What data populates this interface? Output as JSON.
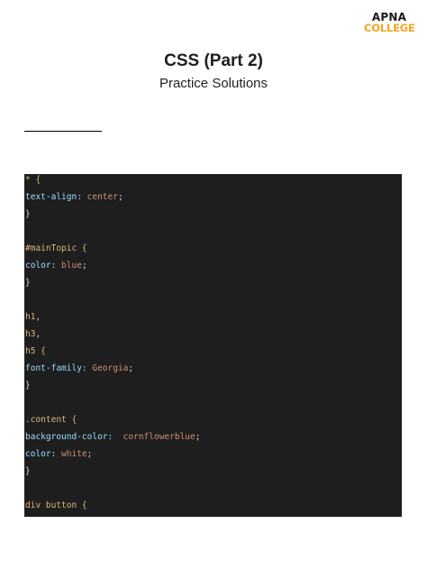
{
  "logo": {
    "line1": "APNA",
    "line2": "COLLEGE"
  },
  "header": {
    "title": "CSS (Part 2)",
    "subtitle": "Practice Solutions"
  },
  "colors": {
    "selector": "#d7ba7d",
    "property": "#9cdcfe",
    "value": "#ce9178",
    "punctuation": "#d4d4d4",
    "code_background": "#1e1e1e",
    "logo_accent": "#f5a623"
  },
  "code": {
    "lines": [
      {
        "selector": "* {"
      },
      {
        "property": "text-align:",
        "value": " center",
        "end": ";"
      },
      {
        "punct": "}"
      },
      {},
      {
        "selector": "#mainTopic {"
      },
      {
        "property": "color:",
        "value": " blue",
        "end": ";"
      },
      {
        "punct": "}"
      },
      {},
      {},
      {
        "selector": "h1",
        "end": ","
      },
      {
        "selector": "h3",
        "end": ","
      },
      {
        "selector": "h5 {"
      },
      {
        "property": "font-family:",
        "value": " Georgia",
        "end": ";"
      },
      {
        "punct": "}"
      },
      {},
      {
        "selector": ".content {"
      },
      {
        "property": "background-color:",
        "value": "  cornflowerblue",
        "end": ";"
      },
      {
        "property": "color:",
        "value": " white",
        "end": ";"
      },
      {
        "punct": "}"
      },
      {},
      {
        "selector": "div button {"
      }
    ]
  }
}
